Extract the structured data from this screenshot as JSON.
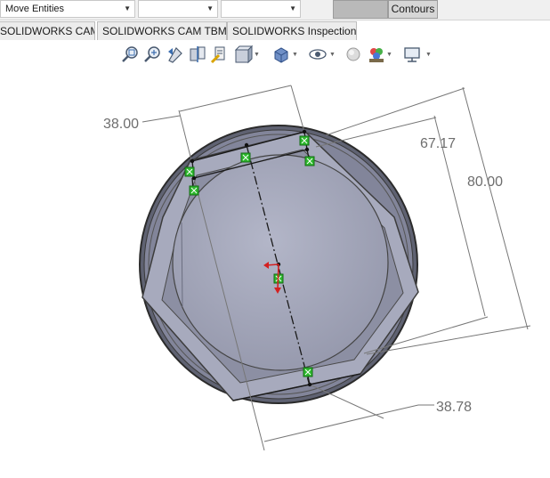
{
  "toolbar": {
    "command_combo": "Move Entities",
    "combo2": "",
    "combo3": "",
    "contours_label": "Contours"
  },
  "tabs": [
    {
      "label": "SOLIDWORKS CAM"
    },
    {
      "label": "SOLIDWORKS CAM TBM"
    },
    {
      "label": "SOLIDWORKS Inspection"
    }
  ],
  "view_toolbar": [
    {
      "icon": "zoom-to-fit-icon"
    },
    {
      "icon": "zoom-to-area-icon"
    },
    {
      "icon": "previous-view-icon"
    },
    {
      "icon": "section-view-icon"
    },
    {
      "icon": "dynamic-annotation-icon"
    },
    {
      "icon": "view-orientation-icon"
    },
    {
      "icon": "display-style-icon"
    },
    {
      "icon": "hide-show-items-icon"
    },
    {
      "icon": "edit-appearance-icon"
    },
    {
      "icon": "apply-scene-icon"
    },
    {
      "icon": "view-settings-icon"
    }
  ],
  "dimensions": {
    "d1": "38.00",
    "d2": "67.17",
    "d3": "80.00",
    "d4": "38.78"
  },
  "colors": {
    "part_face": "#9c9fb3",
    "part_light": "#aeb1c3",
    "part_dark": "#6f7284",
    "relation_marker": "#2db82d",
    "dimension_text": "#6e6e6e"
  }
}
